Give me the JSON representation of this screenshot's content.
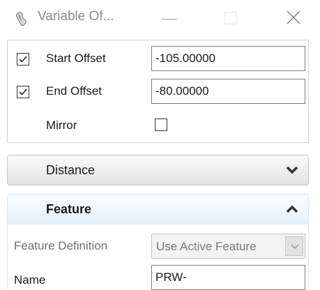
{
  "window": {
    "title": "Variable Of...",
    "icon": "wrench-tool-icon"
  },
  "offsets": {
    "start": {
      "label": "Start Offset",
      "checked": true,
      "value": "-105.00000"
    },
    "end": {
      "label": "End Offset",
      "checked": true,
      "value": "-80.00000"
    },
    "mirror": {
      "label": "Mirror",
      "checked": false
    }
  },
  "sections": {
    "distance": {
      "title": "Distance",
      "expanded": false
    },
    "feature": {
      "title": "Feature",
      "expanded": true
    }
  },
  "feature": {
    "definition_label": "Feature Definition",
    "definition_value": "Use Active Feature",
    "name_label": "Name",
    "name_value": "PRW-"
  }
}
